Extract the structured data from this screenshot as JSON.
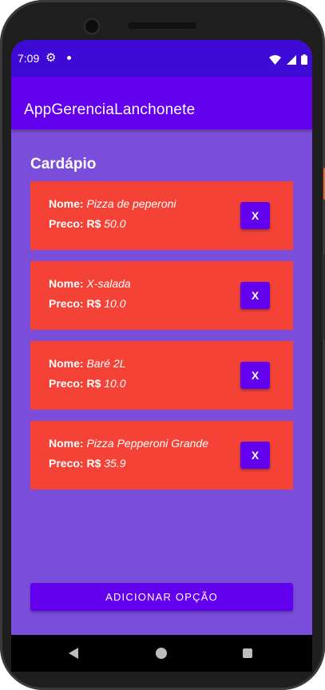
{
  "status_bar": {
    "time": "7:09",
    "icons": [
      "gear-icon",
      "notification-dot-icon",
      "wifi-icon",
      "signal-icon",
      "battery-icon"
    ]
  },
  "app_bar": {
    "title": "AppGerenciaLanchonete"
  },
  "main": {
    "heading": "Cardápio",
    "items": [
      {
        "name_label": "Nome:",
        "name": "Pizza de peperoni",
        "price_label": "Preco: R$",
        "price": "50.0",
        "delete_label": "X"
      },
      {
        "name_label": "Nome:",
        "name": "X-salada",
        "price_label": "Preco: R$",
        "price": "10.0",
        "delete_label": "X"
      },
      {
        "name_label": "Nome:",
        "name": "Baré 2L",
        "price_label": "Preco: R$",
        "price": "10.0",
        "delete_label": "X"
      },
      {
        "name_label": "Nome:",
        "name": "Pizza Pepperoni Grande",
        "price_label": "Preco: R$",
        "price": "35.9",
        "delete_label": "X"
      }
    ],
    "add_button_label": "ADICIONAR OPÇÃO"
  },
  "nav_bar": {
    "icons": [
      "back-icon",
      "home-icon",
      "recents-icon"
    ]
  },
  "colors": {
    "status_bar": "#3d0ad6",
    "app_bar": "#6200ee",
    "background": "#7b4ddb",
    "card": "#f44336",
    "button": "#6200ee"
  }
}
